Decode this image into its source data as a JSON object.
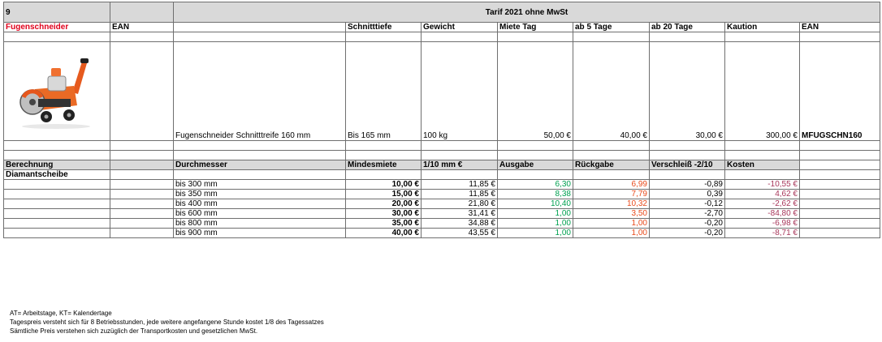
{
  "sheet": {
    "number": "9",
    "title": "Tarif 2021 ohne MwSt"
  },
  "product_header": {
    "name": "Fugenschneider",
    "ean": "EAN",
    "schnitttiefe": "Schnitttiefe",
    "gewicht": "Gewicht",
    "miete_tag": "Miete Tag",
    "ab5": "ab 5 Tage",
    "ab20": "ab 20 Tage",
    "kaution": "Kaution",
    "ean2": "EAN"
  },
  "product": {
    "description": "Fugenschneider Schnitttreife 160 mm",
    "tiefe": "Bis 165 mm",
    "gewicht": "100 kg",
    "miete_tag": "50,00 €",
    "ab5": "40,00 €",
    "ab20": "30,00 €",
    "kaution": "300,00 €",
    "ean": "MFUGSCHN160",
    "image_icon": "floor-saw-machine-icon"
  },
  "calc_header": {
    "berechnung": "Berechnung",
    "durchmesser": "Durchmesser",
    "mindestmiete": "Mindesmiete",
    "per10mm": "1/10 mm €",
    "ausgabe": "Ausgabe",
    "rueckgabe": "Rückgabe",
    "verschleiss": "Verschleiß -2/10",
    "kosten": "Kosten"
  },
  "diamond_label": "Diamantscheibe",
  "rows": [
    {
      "durchmesser": "bis 300 mm",
      "mindestmiete": "10,00 €",
      "per10mm": "11,85 €",
      "ausgabe": "6,30",
      "rueckgabe": "6,99",
      "verschleiss": "-0,89",
      "kosten": "-10,55 €"
    },
    {
      "durchmesser": "bis 350 mm",
      "mindestmiete": "15,00 €",
      "per10mm": "11,85 €",
      "ausgabe": "8,38",
      "rueckgabe": "7,79",
      "verschleiss": "0,39",
      "kosten": "4,62 €"
    },
    {
      "durchmesser": "bis 400 mm",
      "mindestmiete": "20,00 €",
      "per10mm": "21,80 €",
      "ausgabe": "10,40",
      "rueckgabe": "10,32",
      "verschleiss": "-0,12",
      "kosten": "-2,62 €"
    },
    {
      "durchmesser": "bis 600 mm",
      "mindestmiete": "30,00 €",
      "per10mm": "31,41 €",
      "ausgabe": "1,00",
      "rueckgabe": "3,50",
      "verschleiss": "-2,70",
      "kosten": "-84,80 €"
    },
    {
      "durchmesser": "bis 800 mm",
      "mindestmiete": "35,00 €",
      "per10mm": "34,88 €",
      "ausgabe": "1,00",
      "rueckgabe": "1,00",
      "verschleiss": "-0,20",
      "kosten": "-6,98 €"
    },
    {
      "durchmesser": "bis 900 mm",
      "mindestmiete": "40,00 €",
      "per10mm": "43,55 €",
      "ausgabe": "1,00",
      "rueckgabe": "1,00",
      "verschleiss": "-0,20",
      "kosten": "-8,71 €"
    }
  ],
  "notes": [
    "AT= Arbeitstage, KT= Kalendertage",
    "Tagespreis versteht sich für 8 Betriebsstunden, jede weitere angefangene Stunde kostet 1/8 des Tagessatzes",
    "Sämtliche Preis verstehen sich zuzüglich der Transportkosten und gesetzlichen MwSt."
  ],
  "colors": {
    "header_gray": "#d9d9d9",
    "product_red": "#e0001b",
    "ausgabe_green": "#00a050",
    "rueckgabe_orange": "#e84a1b",
    "kosten_purple": "#a8365a"
  }
}
